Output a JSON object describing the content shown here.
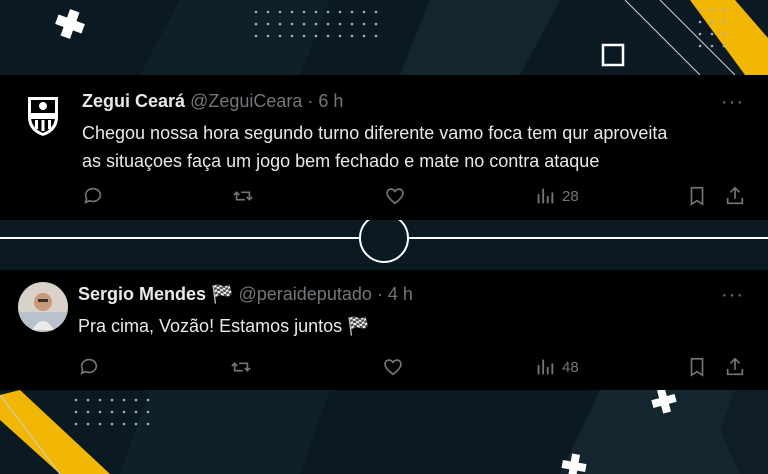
{
  "tweets": [
    {
      "author": "Zegui Ceará",
      "handle": "@ZeguiCeara",
      "separator": "·",
      "time": "6 h",
      "text_line1": "Chegou nossa hora segundo turno diferente vamo foca tem qur aproveita",
      "text_line2": "as situaçoes faça um jogo bem fechado e mate no contra ataque",
      "more": "···",
      "views": "28",
      "avatar": "ceara-crest-icon"
    },
    {
      "author": "Sergio Mendes",
      "author_flag": "🏁",
      "handle": "@peraideputado",
      "separator": "·",
      "time": "4 h",
      "text": "Pra cima, Vozão! Estamos juntos 🏁",
      "more": "···",
      "views": "48",
      "avatar": "user-photo-avatar"
    }
  ],
  "colors": {
    "background": "#0b1a22",
    "tweet_bg": "#000000",
    "text": "#e7e9ea",
    "muted": "#71767b",
    "accent_yellow": "#f2b705"
  }
}
